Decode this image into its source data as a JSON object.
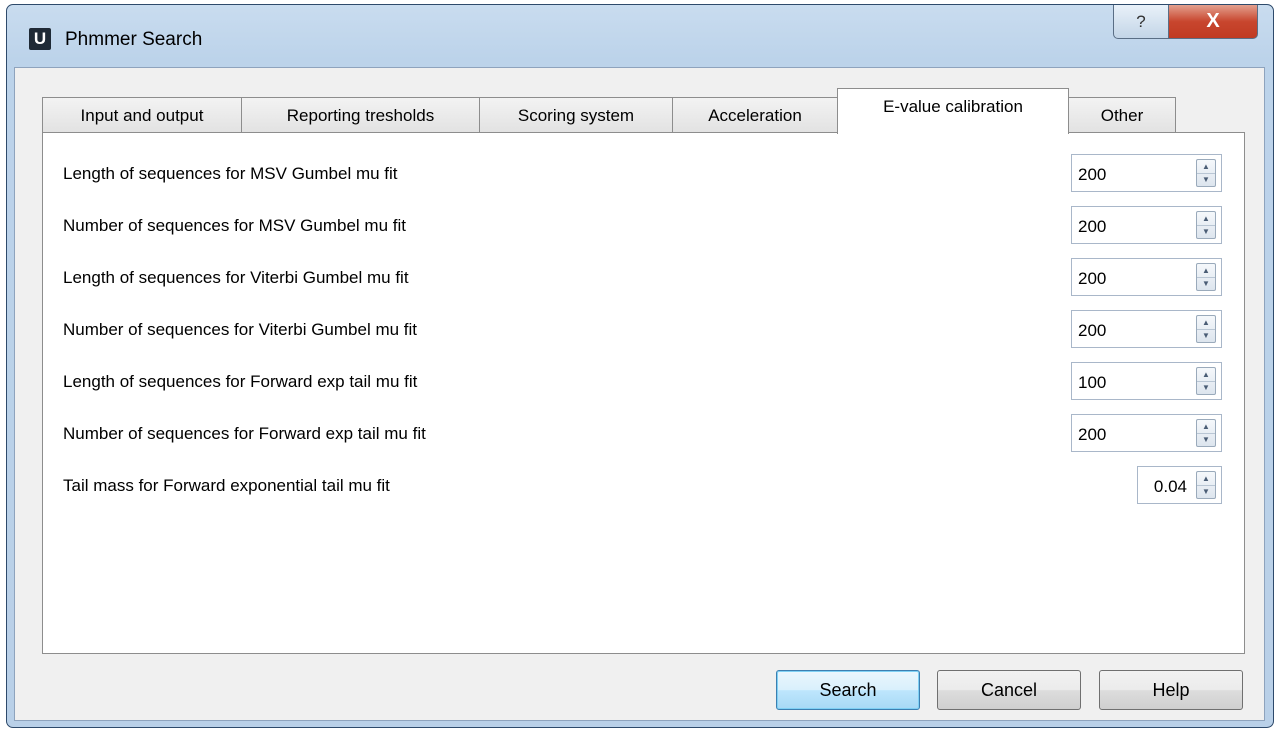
{
  "window": {
    "title": "Phmmer Search",
    "app_icon_letter": "U",
    "help_glyph": "?",
    "close_glyph": "X"
  },
  "tabs": [
    {
      "label": "Input and output",
      "active": false
    },
    {
      "label": "Reporting tresholds",
      "active": false
    },
    {
      "label": "Scoring system",
      "active": false
    },
    {
      "label": "Acceleration",
      "active": false
    },
    {
      "label": "E-value calibration",
      "active": true
    },
    {
      "label": "Other",
      "active": false
    }
  ],
  "fields": [
    {
      "label": "Length of sequences for MSV Gumbel mu fit",
      "value": "200"
    },
    {
      "label": "Number of sequences for MSV Gumbel mu fit",
      "value": "200"
    },
    {
      "label": "Length of sequences for Viterbi Gumbel mu fit",
      "value": "200"
    },
    {
      "label": "Number of sequences for Viterbi Gumbel mu fit",
      "value": "200"
    },
    {
      "label": "Length of sequences for Forward exp tail mu fit",
      "value": "100"
    },
    {
      "label": "Number of sequences for Forward exp tail mu fit",
      "value": "200"
    },
    {
      "label": "Tail mass for Forward exponential tail mu fit",
      "value": "0.04"
    }
  ],
  "buttons": {
    "search": "Search",
    "cancel": "Cancel",
    "help": "Help"
  },
  "icons": {
    "spin_up": "▲",
    "spin_down": "▼"
  }
}
